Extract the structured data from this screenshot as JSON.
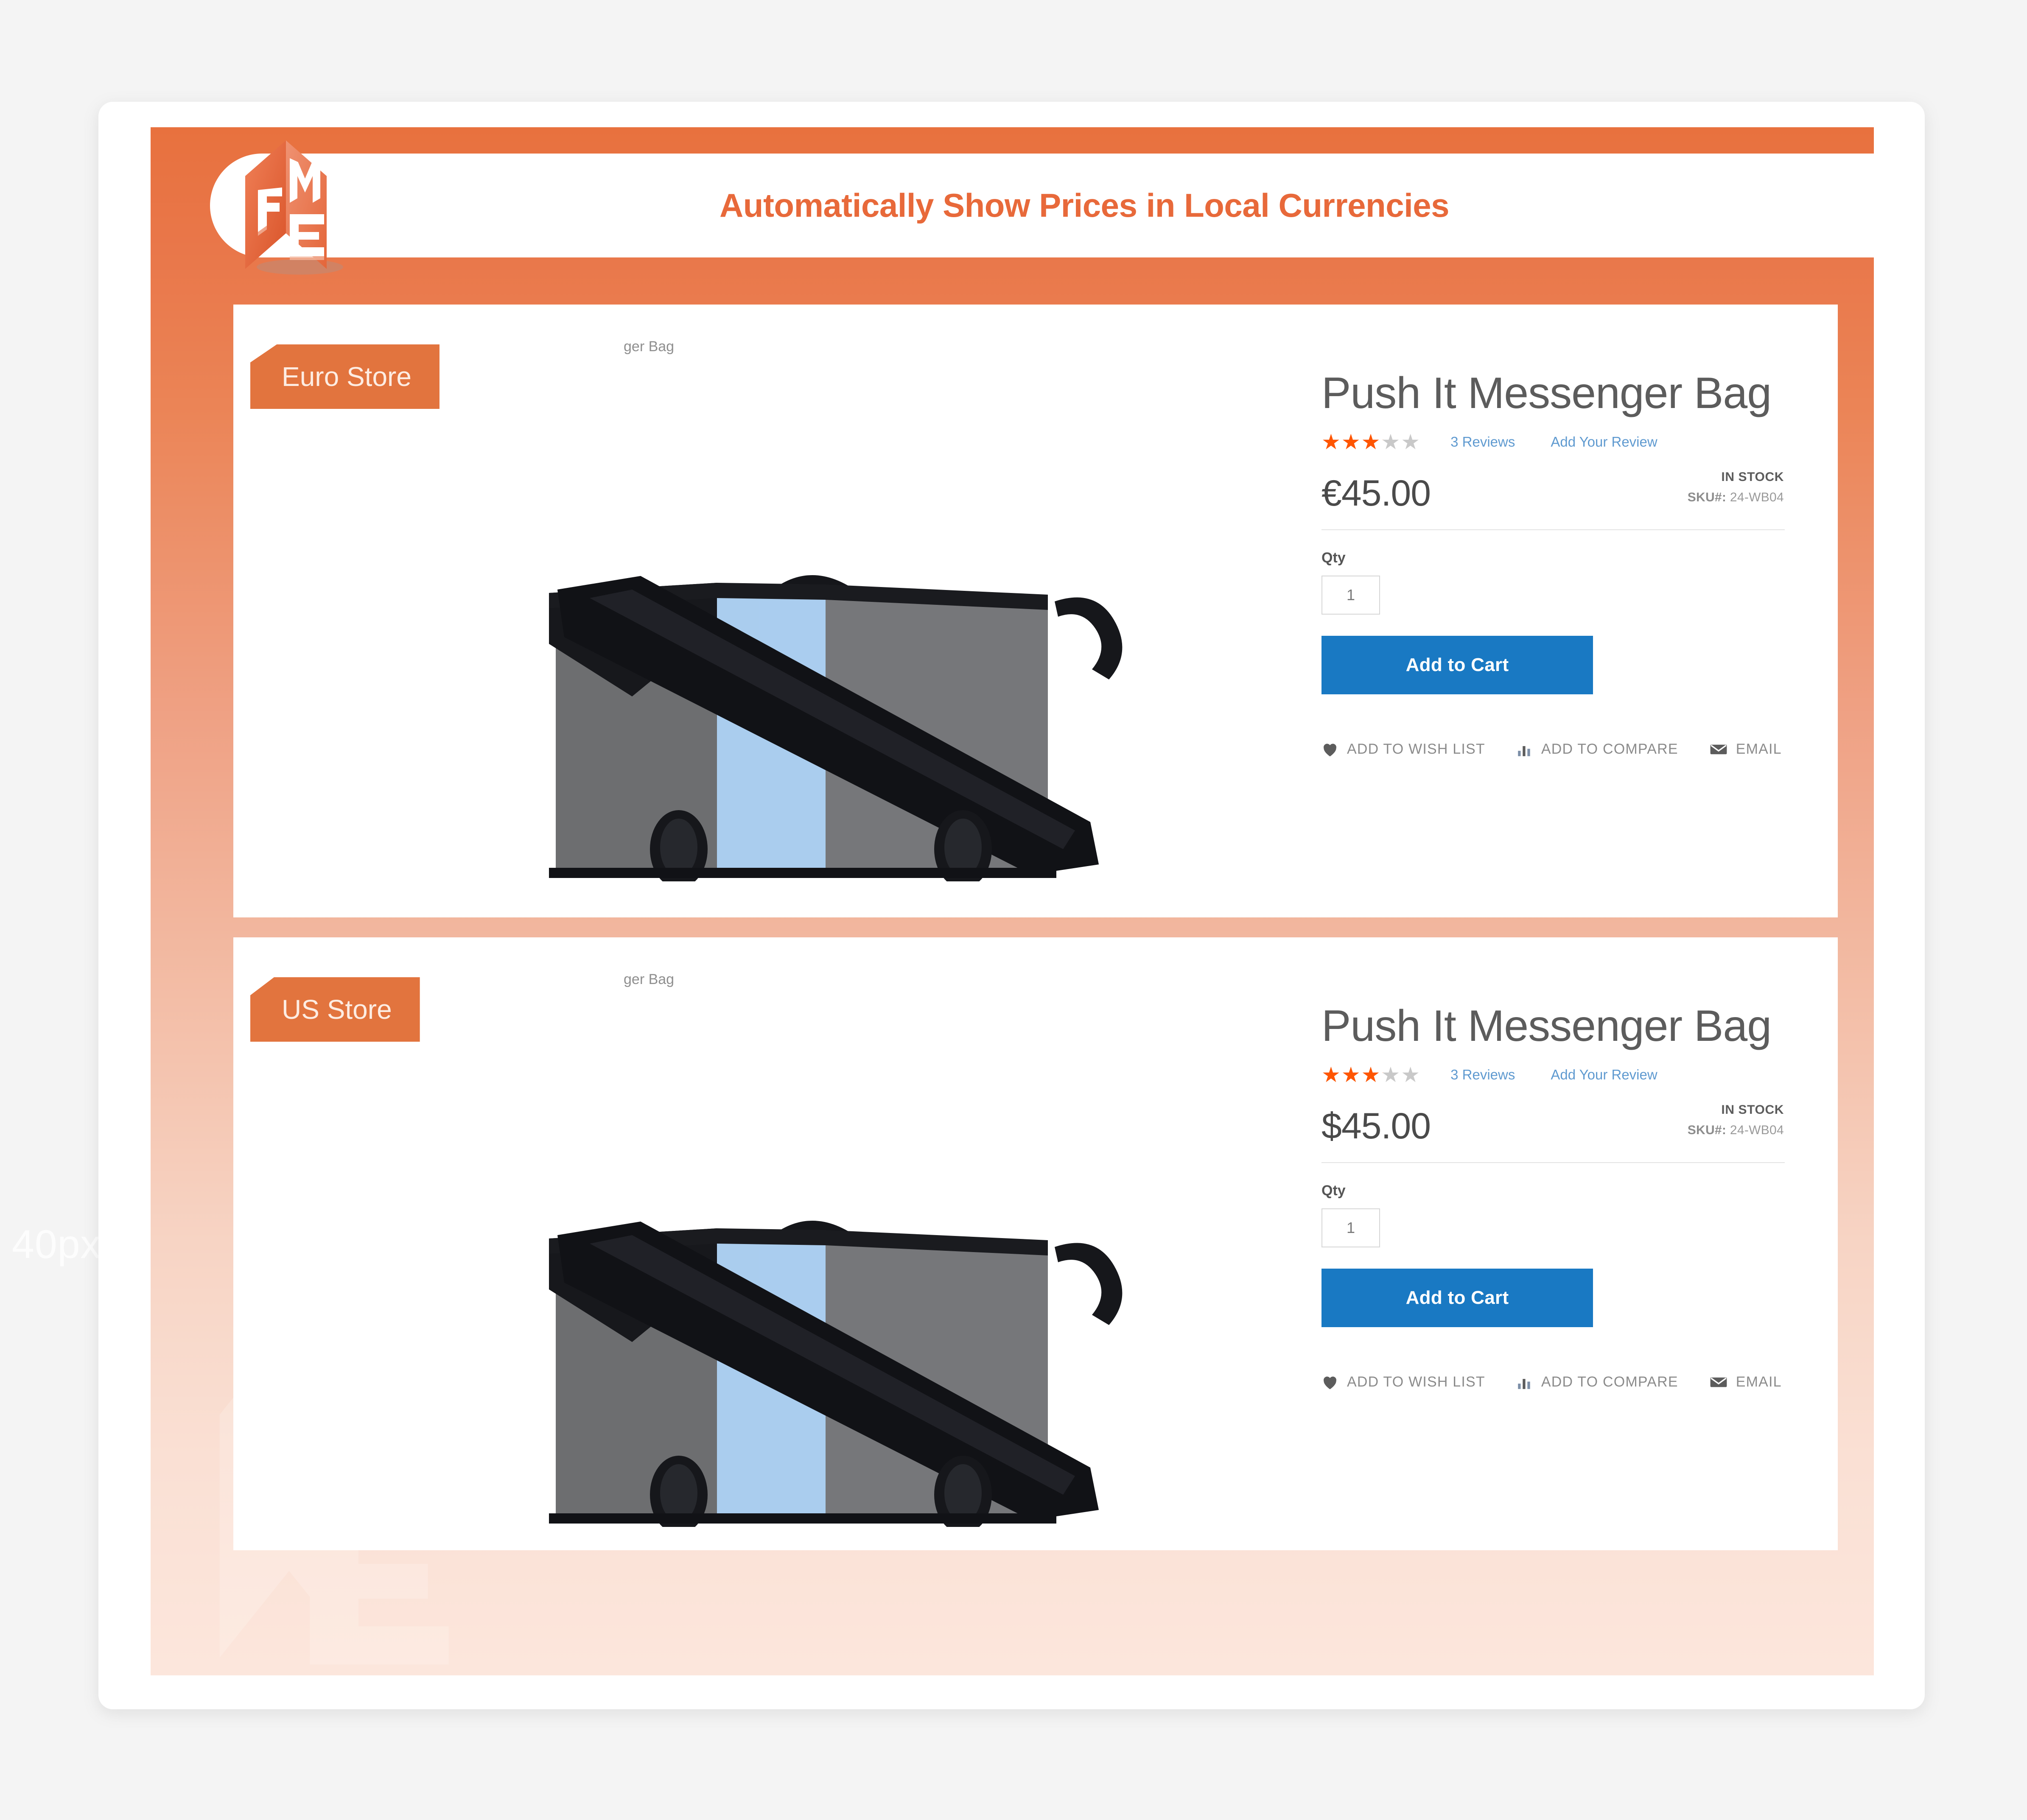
{
  "watermarks": {
    "left_label": "40px"
  },
  "header": {
    "title": "Automatically Show Prices in Local Currencies",
    "logo_icon": "fme-cube-logo-icon",
    "accent_color": "#e8693a",
    "background_color": "#e8713e"
  },
  "stores": [
    {
      "badge": "Euro Store",
      "breadcrumb": "ger Bag",
      "product": {
        "title": "Push It Messenger Bag",
        "rating_percent": 62,
        "stars_glyphs": "★★★★★",
        "reviews_link": "3 Reviews",
        "add_review_link": "Add Your Review",
        "price": "€45.00",
        "stock_status": "IN STOCK",
        "sku_label": "SKU#:",
        "sku_value": "24-WB04",
        "qty_label": "Qty",
        "qty_value": "1",
        "add_to_cart_label": "Add to Cart",
        "actions": [
          {
            "label": "ADD TO WISH LIST",
            "icon": "heart-icon"
          },
          {
            "label": "ADD TO COMPARE",
            "icon": "bar-chart-icon"
          },
          {
            "label": "EMAIL",
            "icon": "envelope-icon"
          }
        ]
      }
    },
    {
      "badge": "US Store",
      "breadcrumb": "ger Bag",
      "product": {
        "title": "Push It Messenger Bag",
        "rating_percent": 62,
        "stars_glyphs": "★★★★★",
        "reviews_link": "3 Reviews",
        "add_review_link": "Add Your Review",
        "price": "$45.00",
        "stock_status": "IN STOCK",
        "sku_label": "SKU#:",
        "sku_value": "24-WB04",
        "qty_label": "Qty",
        "qty_value": "1",
        "add_to_cart_label": "Add to Cart",
        "actions": [
          {
            "label": "ADD TO WISH LIST",
            "icon": "heart-icon"
          },
          {
            "label": "ADD TO COMPARE",
            "icon": "bar-chart-icon"
          },
          {
            "label": "EMAIL",
            "icon": "envelope-icon"
          }
        ]
      }
    }
  ],
  "colors": {
    "brand_orange": "#e2743e",
    "cart_blue": "#1979c3",
    "star_orange": "#ff5501",
    "link_blue": "#5f9ad0"
  }
}
